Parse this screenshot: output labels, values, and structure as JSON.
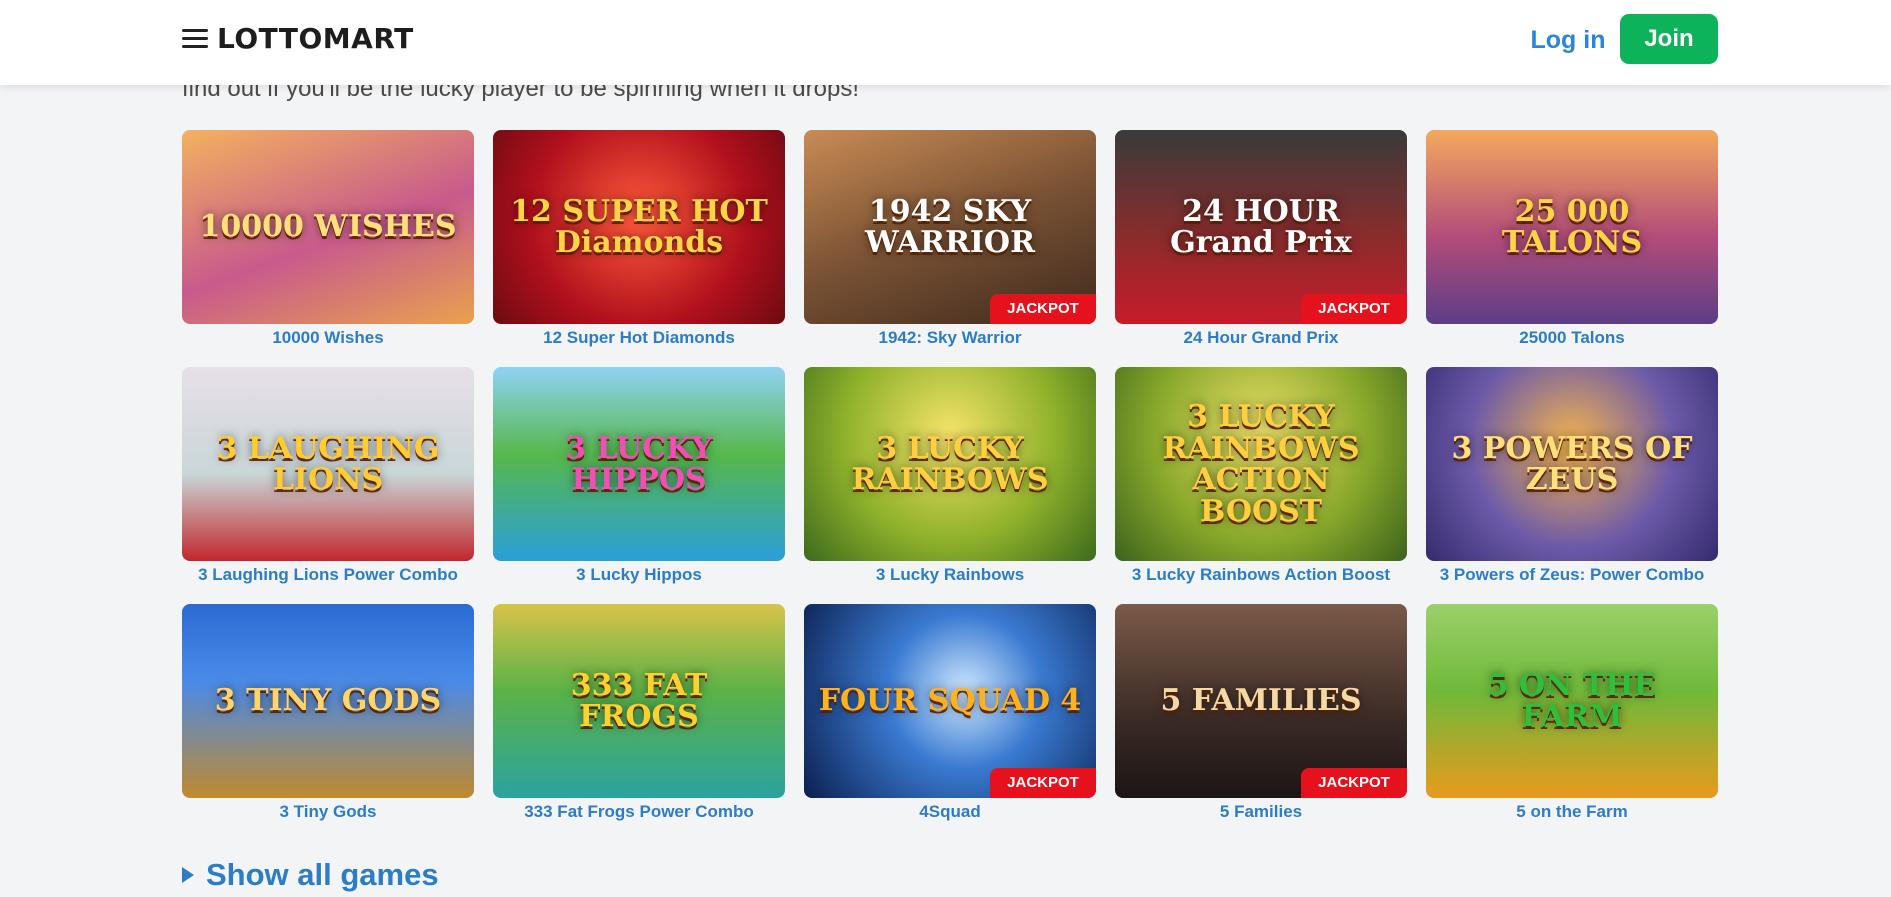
{
  "header": {
    "logo_text": "LOTTOMART",
    "login_label": "Log in",
    "join_label": "Join",
    "menu_icon": "hamburger-icon",
    "colors": {
      "login": "#2c86d8",
      "join_bg": "#0db35a"
    }
  },
  "intro": "find out if you'll be the lucky player to be spinning when it drops!",
  "games": [
    {
      "name": "10000 Wishes",
      "art_text": "10000 WISHES",
      "jackpot": false,
      "bg": "linear-gradient(160deg,#f3b25f,#c85a8c 55%,#e9a24d)",
      "fg": "#ffe07a"
    },
    {
      "name": "12 Super Hot Diamonds",
      "art_text": "12 SUPER HOT Diamonds",
      "jackpot": false,
      "bg": "radial-gradient(circle at 50% 45%,#ff5a3c,#b0101c 60%,#6d0a12)",
      "fg": "#ffd447"
    },
    {
      "name": "1942: Sky Warrior",
      "art_text": "1942 SKY WARRIOR",
      "jackpot": true,
      "bg": "linear-gradient(160deg,#c98b54,#7a5234 50%,#3f2a1d)",
      "fg": "#ffffff"
    },
    {
      "name": "24 Hour Grand Prix",
      "art_text": "24 HOUR Grand Prix",
      "jackpot": true,
      "bg": "linear-gradient(180deg,#3a3a3a,#8a2c2c 55%,#c81b2a)",
      "fg": "#ffffff"
    },
    {
      "name": "25000 Talons",
      "art_text": "25 000 TALONS",
      "jackpot": false,
      "bg": "linear-gradient(180deg,#f4a95d,#b34c7b 55%,#5c3e86)",
      "fg": "#ffd447"
    },
    {
      "name": "3 Laughing Lions Power Combo",
      "art_text": "3 LAUGHING LIONS",
      "jackpot": false,
      "bg": "linear-gradient(180deg,#e8dfe8,#c9d7d8 55%,#c1272d)",
      "fg": "#ffcc33"
    },
    {
      "name": "3 Lucky Hippos",
      "art_text": "3 LUCKY HIPPOS",
      "jackpot": false,
      "bg": "linear-gradient(180deg,#8fd3f4,#56b84b 45%,#2b9fd9)",
      "fg": "#f04fb5"
    },
    {
      "name": "3 Lucky Rainbows",
      "art_text": "3 LUCKY RAINBOWS",
      "jackpot": false,
      "bg": "radial-gradient(circle at 50% 35%,#f5e46a,#8fb12b 55%,#3c6a1c)",
      "fg": "#ffcf3f"
    },
    {
      "name": "3 Lucky Rainbows Action Boost",
      "art_text": "3 LUCKY RAINBOWS ACTION BOOST",
      "jackpot": false,
      "bg": "radial-gradient(circle at 50% 35%,#eee16a,#8aa92b 55%,#3b631c)",
      "fg": "#ffcf3f"
    },
    {
      "name": "3 Powers of Zeus: Power Combo",
      "art_text": "3 POWERS OF ZEUS",
      "jackpot": false,
      "bg": "radial-gradient(circle at 50% 40%,#f6b54c,#6c5aa8 55%,#352a6e)",
      "fg": "#ffe07a"
    },
    {
      "name": "3 Tiny Gods",
      "art_text": "3 TINY GODS",
      "jackpot": false,
      "bg": "linear-gradient(180deg,#2a6bd4,#4a8be8 40%,#c08a2e)",
      "fg": "#ffd46b"
    },
    {
      "name": "333 Fat Frogs Power Combo",
      "art_text": "333 FAT FROGS",
      "jackpot": false,
      "bg": "linear-gradient(180deg,#d7c34a,#5bb247 45%,#2aa3a0)",
      "fg": "#ffd12e"
    },
    {
      "name": "4Squad",
      "art_text": "FOUR SQUAD 4",
      "jackpot": true,
      "bg": "radial-gradient(circle at 55% 45%,#cfe8ff,#3a7ad1 40%,#0b1f4f)",
      "fg": "#ffb21e"
    },
    {
      "name": "5 Families",
      "art_text": "5 FAMILIES",
      "jackpot": true,
      "bg": "linear-gradient(180deg,#7a5a48,#3a2a25 60%,#1c1514)",
      "fg": "#f3d9a3"
    },
    {
      "name": "5 on the Farm",
      "art_text": "5 ON THE FARM",
      "jackpot": false,
      "bg": "linear-gradient(180deg,#9bd06a,#6fb93a 45%,#e89a1e)",
      "fg": "#2fbf3a"
    }
  ],
  "jackpot_label": "JACKPOT",
  "show_all_label": "Show all games"
}
